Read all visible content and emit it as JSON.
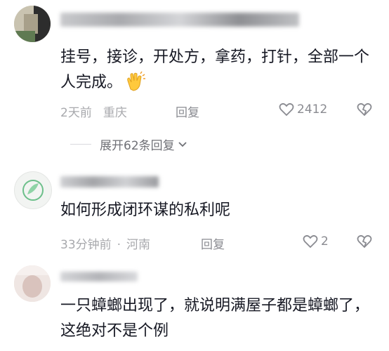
{
  "comments": [
    {
      "username": "",
      "text": "挂号，接诊，开处方，拿药，打针，全部一个人完成。",
      "emoji": "clapping-hands-icon",
      "time": "2天前",
      "location": "重庆",
      "reply_label": "回复",
      "likes": "2412",
      "expand_label": "展开62条回复"
    },
    {
      "username": "",
      "text": "如何形成闭环谋的私利呢",
      "time": "33分钟前",
      "separator": "·",
      "location": "河南",
      "reply_label": "回复",
      "likes": "2"
    },
    {
      "username": "",
      "text": "一只蟑螂出现了，就说明满屋子都是蟑螂了，这绝对不是个例"
    }
  ],
  "colors": {
    "text": "#161823",
    "meta": "#a8a9ad",
    "action": "#8a8b91"
  }
}
